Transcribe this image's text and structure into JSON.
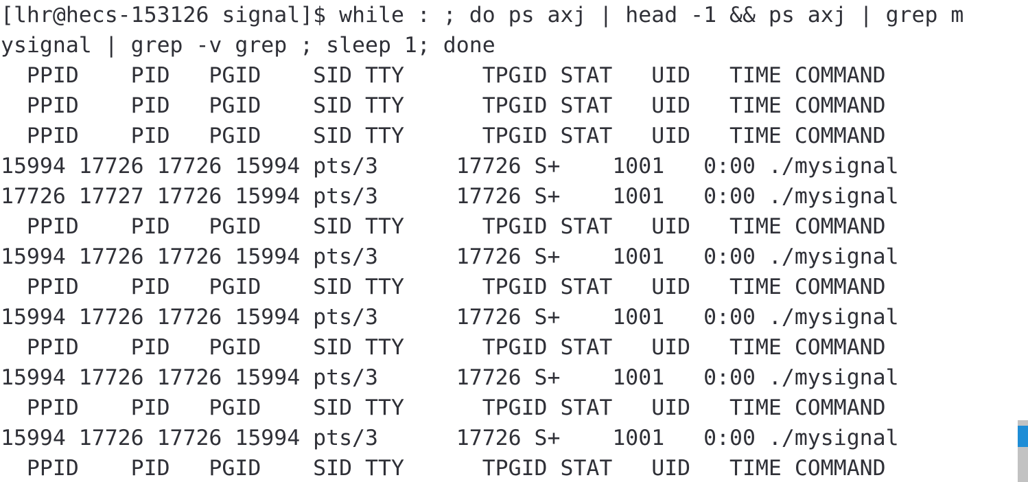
{
  "terminal": {
    "prompt": "[lhr@hecs-153126 signal]$ ",
    "command": "while : ; do ps axj | head -1 && ps axj | grep mysignal | grep -v grep ; sleep 1; done",
    "columns": 79,
    "text_color": "#2f3037",
    "background_color": "#ffffff",
    "header_line": "  PPID    PID   PGID    SID TTY      TPGID STAT   UID   TIME COMMAND",
    "process_row_a": "15994 17726 17726 15994 pts/3      17726 S+    1001   0:00 ./mysignal",
    "process_row_b": "17726 17727 17726 15994 pts/3      17726 S+    1001   0:00 ./mysignal",
    "lines": [
      "[lhr@hecs-153126 signal]$ while : ; do ps axj | head -1 && ps axj | grep m",
      "ysignal | grep -v grep ; sleep 1; done",
      "  PPID    PID   PGID    SID TTY      TPGID STAT   UID   TIME COMMAND",
      "  PPID    PID   PGID    SID TTY      TPGID STAT   UID   TIME COMMAND",
      "  PPID    PID   PGID    SID TTY      TPGID STAT   UID   TIME COMMAND",
      "15994 17726 17726 15994 pts/3      17726 S+    1001   0:00 ./mysignal",
      "17726 17727 17726 15994 pts/3      17726 S+    1001   0:00 ./mysignal",
      "  PPID    PID   PGID    SID TTY      TPGID STAT   UID   TIME COMMAND",
      "15994 17726 17726 15994 pts/3      17726 S+    1001   0:00 ./mysignal",
      "  PPID    PID   PGID    SID TTY      TPGID STAT   UID   TIME COMMAND",
      "15994 17726 17726 15994 pts/3      17726 S+    1001   0:00 ./mysignal",
      "  PPID    PID   PGID    SID TTY      TPGID STAT   UID   TIME COMMAND",
      "15994 17726 17726 15994 pts/3      17726 S+    1001   0:00 ./mysignal",
      "  PPID    PID   PGID    SID TTY      TPGID STAT   UID   TIME COMMAND",
      "15994 17726 17726 15994 pts/3      17726 S+    1001   0:00 ./mysignal",
      "  PPID    PID   PGID    SID TTY      TPGID STAT   UID   TIME COMMAND"
    ],
    "ps_columns": [
      "PPID",
      "PID",
      "PGID",
      "SID",
      "TTY",
      "TPGID",
      "STAT",
      "UID",
      "TIME",
      "COMMAND"
    ],
    "process_table": [
      {
        "ppid": "15994",
        "pid": "17726",
        "pgid": "17726",
        "sid": "15994",
        "tty": "pts/3",
        "tpgid": "17726",
        "stat": "S+",
        "uid": "1001",
        "time": "0:00",
        "command": "./mysignal"
      },
      {
        "ppid": "17726",
        "pid": "17727",
        "pgid": "17726",
        "sid": "15994",
        "tty": "pts/3",
        "tpgid": "17726",
        "stat": "S+",
        "uid": "1001",
        "time": "0:00",
        "command": "./mysignal"
      }
    ]
  },
  "scrollbar": {
    "track_color": "#c2c2c2",
    "thumb_color": "#1f8dd6",
    "orientation": "vertical"
  }
}
